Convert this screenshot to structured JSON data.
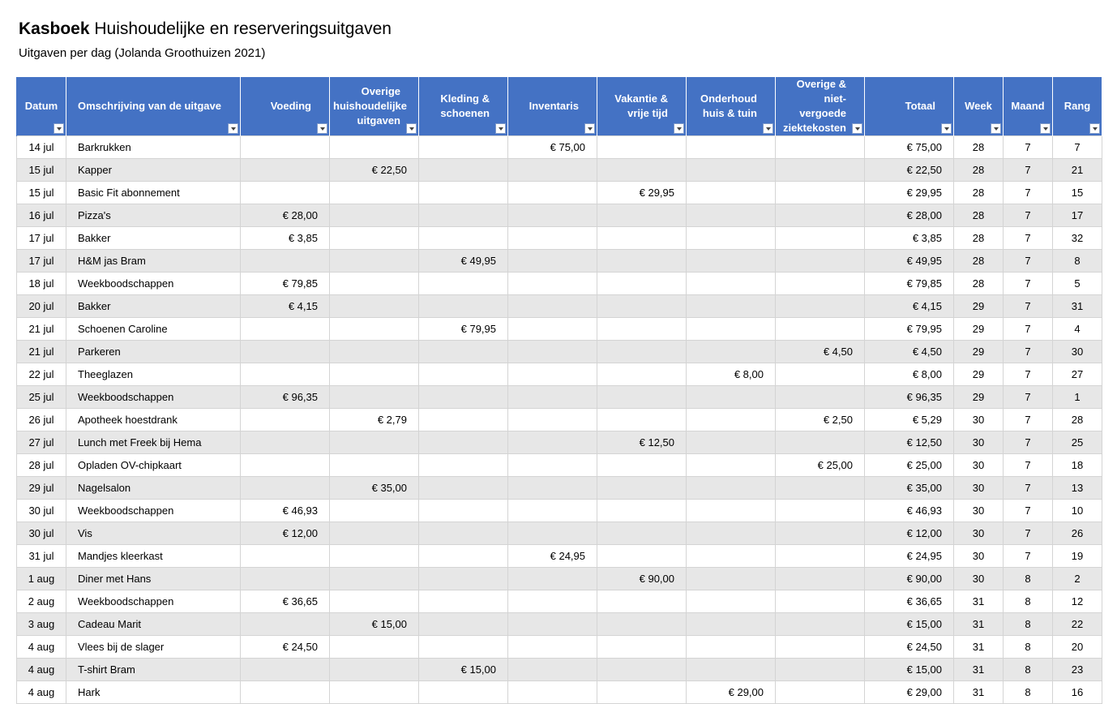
{
  "title": {
    "bold": "Kasboek",
    "rest": " Huishoudelijke en reserveringsuitgaven"
  },
  "subtitle": "Uitgaven per dag (Jolanda Groothuizen 2021)",
  "columns": [
    "Datum",
    "Omschrijving van de uitgave",
    "Voeding",
    "Overige huishoudelijke uitgaven",
    "Kleding & schoenen",
    "Inventaris",
    "Vakantie & vrije tijd",
    "Onderhoud huis & tuin",
    "Overige & niet-vergoede ziektekosten",
    "Totaal",
    "Week",
    "Maand",
    "Rang"
  ],
  "rows": [
    [
      "14 jul",
      "Barkrukken",
      "",
      "",
      "",
      "€ 75,00",
      "",
      "",
      "",
      "€ 75,00",
      "28",
      "7",
      "7"
    ],
    [
      "15 jul",
      "Kapper",
      "",
      "€ 22,50",
      "",
      "",
      "",
      "",
      "",
      "€ 22,50",
      "28",
      "7",
      "21"
    ],
    [
      "15 jul",
      "Basic Fit abonnement",
      "",
      "",
      "",
      "",
      "€ 29,95",
      "",
      "",
      "€ 29,95",
      "28",
      "7",
      "15"
    ],
    [
      "16 jul",
      "Pizza's",
      "€ 28,00",
      "",
      "",
      "",
      "",
      "",
      "",
      "€ 28,00",
      "28",
      "7",
      "17"
    ],
    [
      "17 jul",
      "Bakker",
      "€ 3,85",
      "",
      "",
      "",
      "",
      "",
      "",
      "€ 3,85",
      "28",
      "7",
      "32"
    ],
    [
      "17 jul",
      "H&M jas Bram",
      "",
      "",
      "€ 49,95",
      "",
      "",
      "",
      "",
      "€ 49,95",
      "28",
      "7",
      "8"
    ],
    [
      "18 jul",
      "Weekboodschappen",
      "€ 79,85",
      "",
      "",
      "",
      "",
      "",
      "",
      "€ 79,85",
      "28",
      "7",
      "5"
    ],
    [
      "20 jul",
      "Bakker",
      "€ 4,15",
      "",
      "",
      "",
      "",
      "",
      "",
      "€ 4,15",
      "29",
      "7",
      "31"
    ],
    [
      "21 jul",
      "Schoenen Caroline",
      "",
      "",
      "€ 79,95",
      "",
      "",
      "",
      "",
      "€ 79,95",
      "29",
      "7",
      "4"
    ],
    [
      "21 jul",
      "Parkeren",
      "",
      "",
      "",
      "",
      "",
      "",
      "€ 4,50",
      "€ 4,50",
      "29",
      "7",
      "30"
    ],
    [
      "22 jul",
      "Theeglazen",
      "",
      "",
      "",
      "",
      "",
      "€ 8,00",
      "",
      "€ 8,00",
      "29",
      "7",
      "27"
    ],
    [
      "25 jul",
      "Weekboodschappen",
      "€ 96,35",
      "",
      "",
      "",
      "",
      "",
      "",
      "€ 96,35",
      "29",
      "7",
      "1"
    ],
    [
      "26 jul",
      "Apotheek hoestdrank",
      "",
      "€ 2,79",
      "",
      "",
      "",
      "",
      "€ 2,50",
      "€ 5,29",
      "30",
      "7",
      "28"
    ],
    [
      "27 jul",
      "Lunch met Freek bij Hema",
      "",
      "",
      "",
      "",
      "€ 12,50",
      "",
      "",
      "€ 12,50",
      "30",
      "7",
      "25"
    ],
    [
      "28 jul",
      "Opladen OV-chipkaart",
      "",
      "",
      "",
      "",
      "",
      "",
      "€ 25,00",
      "€ 25,00",
      "30",
      "7",
      "18"
    ],
    [
      "29 jul",
      "Nagelsalon",
      "",
      "€ 35,00",
      "",
      "",
      "",
      "",
      "",
      "€ 35,00",
      "30",
      "7",
      "13"
    ],
    [
      "30 jul",
      "Weekboodschappen",
      "€ 46,93",
      "",
      "",
      "",
      "",
      "",
      "",
      "€ 46,93",
      "30",
      "7",
      "10"
    ],
    [
      "30 jul",
      "Vis",
      "€ 12,00",
      "",
      "",
      "",
      "",
      "",
      "",
      "€ 12,00",
      "30",
      "7",
      "26"
    ],
    [
      "31 jul",
      "Mandjes kleerkast",
      "",
      "",
      "",
      "€ 24,95",
      "",
      "",
      "",
      "€ 24,95",
      "30",
      "7",
      "19"
    ],
    [
      "1 aug",
      "Diner met Hans",
      "",
      "",
      "",
      "",
      "€ 90,00",
      "",
      "",
      "€ 90,00",
      "30",
      "8",
      "2"
    ],
    [
      "2 aug",
      "Weekboodschappen",
      "€ 36,65",
      "",
      "",
      "",
      "",
      "",
      "",
      "€ 36,65",
      "31",
      "8",
      "12"
    ],
    [
      "3 aug",
      "Cadeau Marit",
      "",
      "€ 15,00",
      "",
      "",
      "",
      "",
      "",
      "€ 15,00",
      "31",
      "8",
      "22"
    ],
    [
      "4 aug",
      "Vlees bij de slager",
      "€ 24,50",
      "",
      "",
      "",
      "",
      "",
      "",
      "€ 24,50",
      "31",
      "8",
      "20"
    ],
    [
      "4 aug",
      "T-shirt Bram",
      "",
      "",
      "€ 15,00",
      "",
      "",
      "",
      "",
      "€ 15,00",
      "31",
      "8",
      "23"
    ],
    [
      "4 aug",
      "Hark",
      "",
      "",
      "",
      "",
      "",
      "€ 29,00",
      "",
      "€ 29,00",
      "31",
      "8",
      "16"
    ]
  ],
  "colors": {
    "header": "#4472c4",
    "band": "#e7e7e7"
  }
}
